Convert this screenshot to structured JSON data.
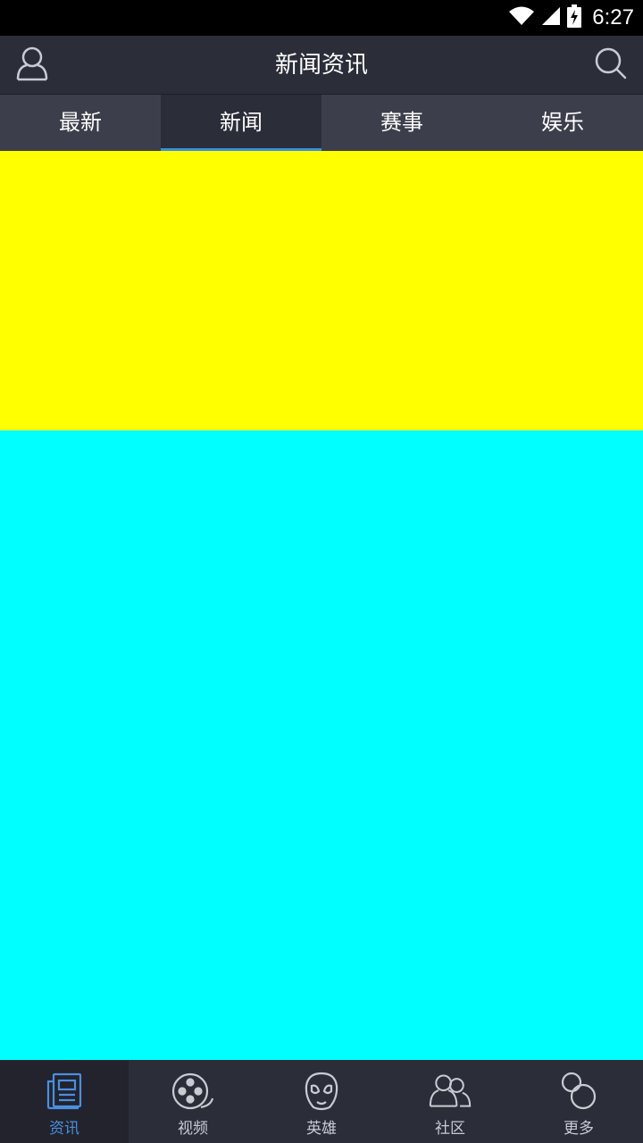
{
  "status_bar": {
    "time": "6:27"
  },
  "header": {
    "title": "新闻资讯"
  },
  "tabs": [
    {
      "label": "最新",
      "active": false
    },
    {
      "label": "新闻",
      "active": true
    },
    {
      "label": "赛事",
      "active": false
    },
    {
      "label": "娱乐",
      "active": false
    }
  ],
  "bottom_nav": [
    {
      "label": "资讯",
      "icon": "news-icon",
      "active": true
    },
    {
      "label": "视频",
      "icon": "film-reel-icon",
      "active": false
    },
    {
      "label": "英雄",
      "icon": "hero-mask-icon",
      "active": false
    },
    {
      "label": "社区",
      "icon": "community-icon",
      "active": false
    },
    {
      "label": "更多",
      "icon": "more-circles-icon",
      "active": false
    }
  ],
  "colors": {
    "header_bg": "#2b2d38",
    "tab_bg": "#3c3f4b",
    "accent": "#3a8ee6",
    "banner": "#ffff00",
    "content": "#00ffff"
  }
}
